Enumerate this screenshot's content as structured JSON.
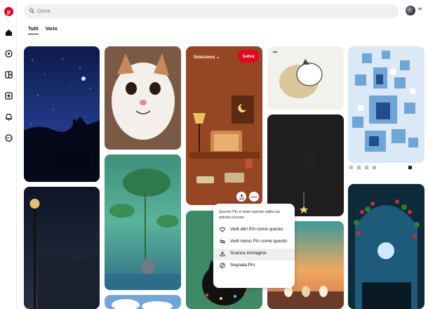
{
  "search": {
    "placeholder": "Cerca"
  },
  "tabs": [
    {
      "label": "Tutti",
      "active": true
    },
    {
      "label": "Vario",
      "active": false
    }
  ],
  "hovered_pin": {
    "select_label": "Seleziona",
    "save_label": "Salva"
  },
  "context_menu": {
    "header": "Questo Pin è stato ispirato dalla tua attività recente",
    "items": [
      {
        "label": "Vedi altri Pin come questo",
        "icon": "heart-icon"
      },
      {
        "label": "Vedi meno Pin come questo",
        "icon": "eye-off-icon"
      },
      {
        "label": "Scarica immagine",
        "icon": "download-icon"
      },
      {
        "label": "Segnala Pin",
        "icon": "block-icon"
      }
    ]
  },
  "colors": {
    "brand_red": "#e60023",
    "search_bg": "#efefef"
  }
}
